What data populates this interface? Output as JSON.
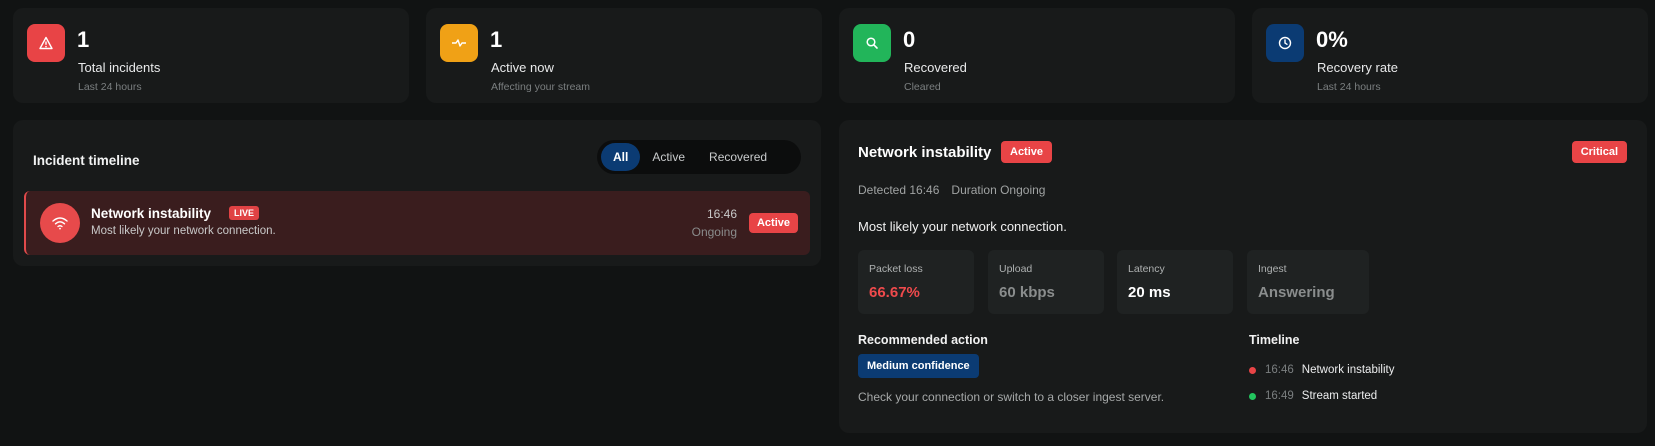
{
  "stats": [
    {
      "value": "1",
      "label": "Total incidents",
      "sub": "Last 24 hours",
      "icon": "warning-triangle-icon",
      "color": "#e84446"
    },
    {
      "value": "1",
      "label": "Active now",
      "sub": "Affecting your stream",
      "icon": "pulse-icon",
      "color": "#f0a116"
    },
    {
      "value": "0",
      "label": "Recovered",
      "sub": "Cleared",
      "icon": "search-icon",
      "color": "#22b55a"
    },
    {
      "value": "0%",
      "label": "Recovery rate",
      "sub": "Last 24 hours",
      "icon": "clock-icon",
      "color": "#0b3b73"
    }
  ],
  "timeline": {
    "title": "Incident timeline",
    "filters": [
      {
        "label": "All",
        "selected": true
      },
      {
        "label": "Active",
        "selected": false
      },
      {
        "label": "Recovered",
        "selected": false
      }
    ],
    "items": [
      {
        "title": "Network instability",
        "live_badge": "LIVE",
        "description": "Most likely your network connection.",
        "time": "16:46",
        "duration": "Ongoing",
        "status": "Active",
        "icon": "wifi-icon"
      }
    ]
  },
  "detail": {
    "title": "Network instability",
    "status": "Active",
    "severity": "Critical",
    "detected": "Detected 16:46",
    "duration": "Duration Ongoing",
    "description": "Most likely your network connection.",
    "metrics": [
      {
        "label": "Packet loss",
        "value": "66.67%",
        "color": "#ef4a4c"
      },
      {
        "label": "Upload",
        "value": "60 kbps",
        "color": "#8a8d8d"
      },
      {
        "label": "Latency",
        "value": "20 ms",
        "color": "#ffffff"
      },
      {
        "label": "Ingest",
        "value": "Answering",
        "color": "#8a8d8d"
      }
    ],
    "recommended": {
      "title": "Recommended action",
      "confidence": "Medium confidence",
      "text": "Check your connection or switch to a closer ingest server."
    },
    "events_title": "Timeline",
    "events": [
      {
        "time": "16:46",
        "label": "Network instability",
        "color": "#e84446"
      },
      {
        "time": "16:49",
        "label": "Stream started",
        "color": "#22c55e"
      }
    ]
  }
}
